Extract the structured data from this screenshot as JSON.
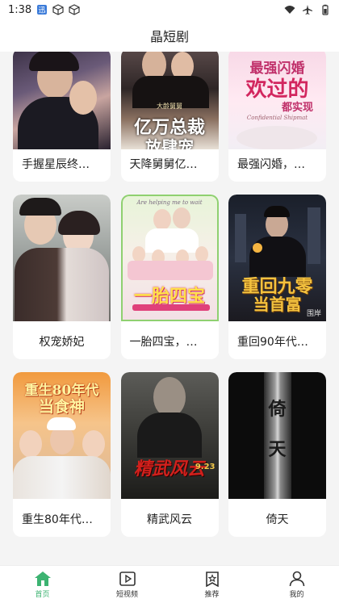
{
  "status": {
    "time": "1:38"
  },
  "header": {
    "title": "晶短剧"
  },
  "colors": {
    "accent": "#3cb371"
  },
  "dramas": [
    {
      "title": "手握星辰终…"
    },
    {
      "title": "天降舅舅亿…",
      "poster_text_1": "亿万总裁",
      "poster_text_2": "放肆宠",
      "poster_tag": "大龄舅舅"
    },
    {
      "title": "最强闪婚，…",
      "poster_text_1": "最强闪婚",
      "poster_text_2": "欢过的",
      "poster_text_3": "都实现",
      "poster_sub": "Confidential Shipmat"
    },
    {
      "title": "权宠娇妃"
    },
    {
      "title": "一胎四宝，…",
      "poster_text_1": "一胎四宝",
      "poster_sub": "Are helping me to wait"
    },
    {
      "title": "重回90年代…",
      "poster_text_1": "重回九零",
      "poster_text_2": "当首富",
      "poster_tag": "围岸"
    },
    {
      "title": "重生80年代…",
      "poster_text_1": "重生80年代",
      "poster_text_2": "当食神"
    },
    {
      "title": "精武风云",
      "poster_text_1": "精武风云",
      "poster_tag": "9.23"
    },
    {
      "title": "倚天",
      "poster_text_1": "倚",
      "poster_text_2": "天"
    }
  ],
  "nav": [
    {
      "label": "首页",
      "icon": "home-icon"
    },
    {
      "label": "短视频",
      "icon": "video-icon"
    },
    {
      "label": "推荐",
      "icon": "star-icon"
    },
    {
      "label": "我的",
      "icon": "person-icon"
    }
  ]
}
